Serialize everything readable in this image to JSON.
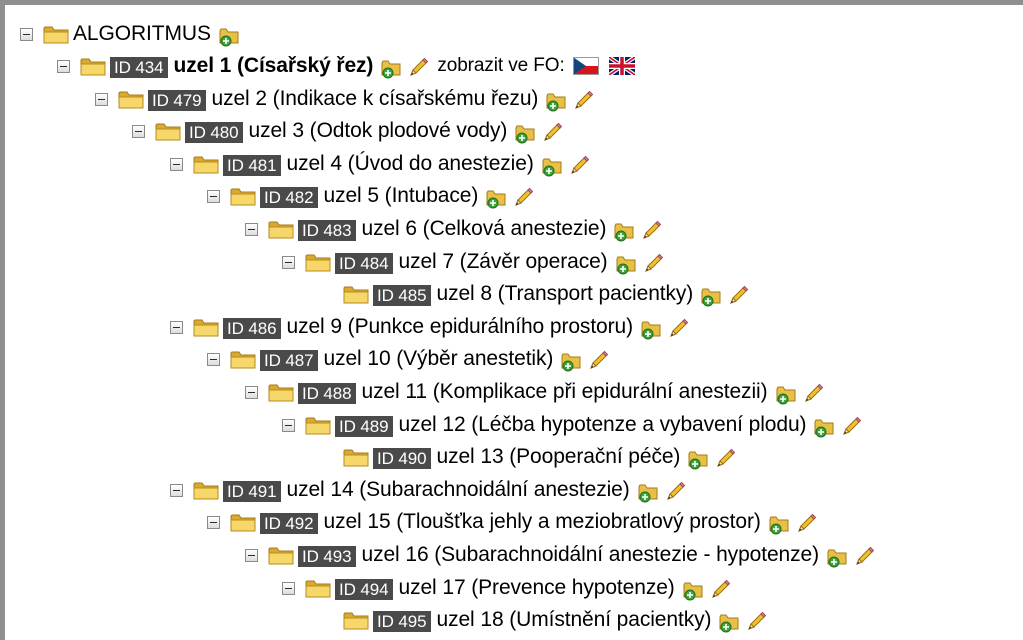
{
  "tree": {
    "root": {
      "label": "ALGORITMUS"
    },
    "nodes": [
      {
        "id": "ID 434",
        "label": "uzel 1 (Císařský řez)",
        "bold": true,
        "depth": 0,
        "toggle": true,
        "fo": "zobrazit ve FO:"
      },
      {
        "id": "ID 479",
        "label": "uzel 2 (Indikace k císařskému řezu)",
        "depth": 1,
        "toggle": true
      },
      {
        "id": "ID 480",
        "label": "uzel 3 (Odtok plodové vody)",
        "depth": 2,
        "toggle": true
      },
      {
        "id": "ID 481",
        "label": "uzel 4 (Úvod do anestezie)",
        "depth": 3,
        "toggle": true
      },
      {
        "id": "ID 482",
        "label": "uzel 5 (Intubace)",
        "depth": 4,
        "toggle": true
      },
      {
        "id": "ID 483",
        "label": "uzel 6 (Celková anestezie)",
        "depth": 5,
        "toggle": true
      },
      {
        "id": "ID 484",
        "label": "uzel 7 (Závěr operace)",
        "depth": 6,
        "toggle": true
      },
      {
        "id": "ID 485",
        "label": "uzel 8 (Transport pacientky)",
        "depth": 7,
        "toggle": false
      },
      {
        "id": "ID 486",
        "label": "uzel 9 (Punkce epidurálního prostoru)",
        "depth": 3,
        "toggle": true
      },
      {
        "id": "ID 487",
        "label": "uzel 10 (Výběr anestetik)",
        "depth": 4,
        "toggle": true
      },
      {
        "id": "ID 488",
        "label": "uzel 11 (Komplikace při epidurální anestezii)",
        "depth": 5,
        "toggle": true
      },
      {
        "id": "ID 489",
        "label": "uzel 12 (Léčba hypotenze a vybavení plodu)",
        "depth": 6,
        "toggle": true
      },
      {
        "id": "ID 490",
        "label": "uzel 13 (Pooperační péče)",
        "depth": 7,
        "toggle": false
      },
      {
        "id": "ID 491",
        "label": "uzel 14 (Subarachnoidální anestezie)",
        "depth": 3,
        "toggle": true
      },
      {
        "id": "ID 492",
        "label": "uzel 15 (Tloušťka jehly a meziobratlový prostor)",
        "depth": 4,
        "toggle": true
      },
      {
        "id": "ID 493",
        "label": "uzel 16 (Subarachnoidální anestezie - hypotenze)",
        "depth": 5,
        "toggle": true
      },
      {
        "id": "ID 494",
        "label": "uzel 17 (Prevence hypotenze)",
        "depth": 6,
        "toggle": true
      },
      {
        "id": "ID 495",
        "label": "uzel 18 (Umístnění pacientky)",
        "depth": 7,
        "toggle": false
      }
    ]
  },
  "icons": {
    "toggle": "collapse-toggle-icon",
    "folder": "folder-icon",
    "add": "folder-add-icon",
    "edit": "pencil-edit-icon",
    "flag_cz": "czech-flag-icon",
    "flag_gb": "uk-flag-icon"
  },
  "colors": {
    "id_badge_bg": "#4a4a4a",
    "folder_yellow": "#f2cf5b",
    "frame": "#8f8f8f"
  }
}
